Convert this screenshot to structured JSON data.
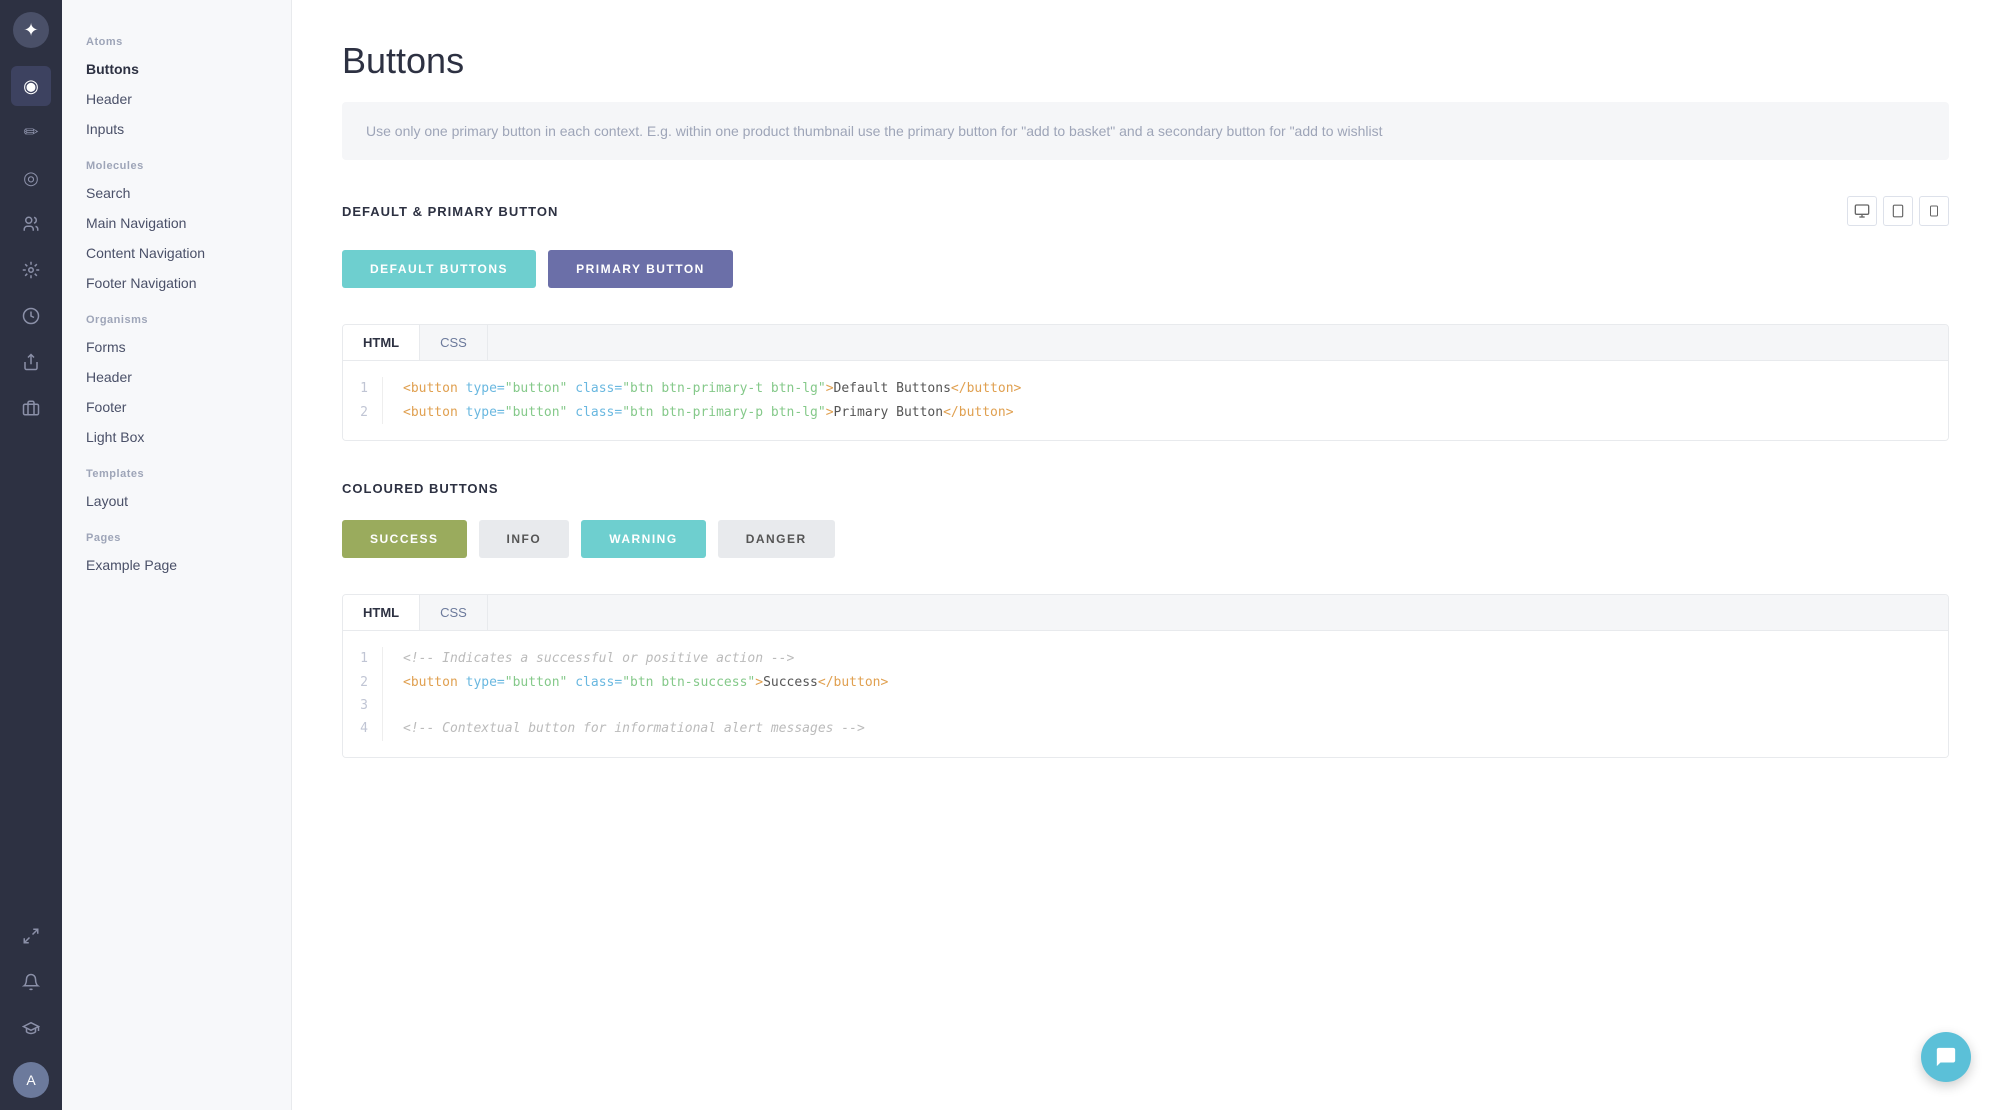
{
  "app": {
    "title": "Buttons"
  },
  "iconRail": {
    "logo": "✦",
    "icons": [
      {
        "name": "eye-icon",
        "glyph": "◉",
        "active": true
      },
      {
        "name": "pencil-icon",
        "glyph": "✏"
      },
      {
        "name": "chart-icon",
        "glyph": "◎"
      },
      {
        "name": "users-icon",
        "glyph": "👤"
      },
      {
        "name": "settings-icon",
        "glyph": "⚙"
      },
      {
        "name": "clock-icon",
        "glyph": "🕐"
      },
      {
        "name": "upload-icon",
        "glyph": "⬆"
      },
      {
        "name": "briefcase-icon",
        "glyph": "💼"
      },
      {
        "name": "expand-icon",
        "glyph": "↗"
      },
      {
        "name": "bell-icon",
        "glyph": "🔔"
      }
    ]
  },
  "sidebar": {
    "sections": [
      {
        "title": "Atoms",
        "items": [
          {
            "label": "Buttons",
            "active": true
          },
          {
            "label": "Header",
            "active": false
          },
          {
            "label": "Inputs",
            "active": false
          }
        ]
      },
      {
        "title": "Molecules",
        "items": [
          {
            "label": "Search",
            "active": false
          },
          {
            "label": "Main Navigation",
            "active": false
          },
          {
            "label": "Content Navigation",
            "active": false
          },
          {
            "label": "Footer Navigation",
            "active": false
          }
        ]
      },
      {
        "title": "Organisms",
        "items": [
          {
            "label": "Forms",
            "active": false
          },
          {
            "label": "Header",
            "active": false
          },
          {
            "label": "Footer",
            "active": false
          },
          {
            "label": "Light Box",
            "active": false
          }
        ]
      },
      {
        "title": "Templates",
        "items": [
          {
            "label": "Layout",
            "active": false
          }
        ]
      },
      {
        "title": "Pages",
        "items": [
          {
            "label": "Example Page",
            "active": false
          }
        ]
      }
    ]
  },
  "main": {
    "pageTitle": "Buttons",
    "infoText": "Use only one primary button in each context. E.g. within one product thumbnail use the primary button for \"add to basket\" and a secondary button for \"add to wishlist",
    "sections": [
      {
        "id": "default-primary",
        "title": "DEFAULT & PRIMARY BUTTON",
        "buttons": [
          {
            "label": "DEFAULT BUTTONS",
            "class": "default"
          },
          {
            "label": "PRIMARY BUTTON",
            "class": "primary"
          }
        ],
        "codeLines": [
          "<button type=\"button\" class=\"btn btn-primary-t btn-lg\">Default Buttons</button>",
          "<button type=\"button\" class=\"btn btn-primary-p btn-lg\">Primary Button</button>"
        ]
      },
      {
        "id": "coloured",
        "title": "COLOURED BUTTONS",
        "buttons": [
          {
            "label": "SUCCESS",
            "class": "success"
          },
          {
            "label": "INFO",
            "class": "info"
          },
          {
            "label": "WARNING",
            "class": "warning"
          },
          {
            "label": "DANGER",
            "class": "danger"
          }
        ],
        "codeLines": [
          "<!-- Indicates a successful or positive action -->",
          "<button type=\"button\" class=\"btn btn-success\">Success</button>",
          "",
          "<!-- Contextual button for informational alert messages -->"
        ]
      }
    ]
  },
  "codeTabs": {
    "html": "HTML",
    "css": "CSS"
  },
  "viewIcons": {
    "desktop": "🖥",
    "tablet": "📱",
    "mobile": "📲"
  }
}
